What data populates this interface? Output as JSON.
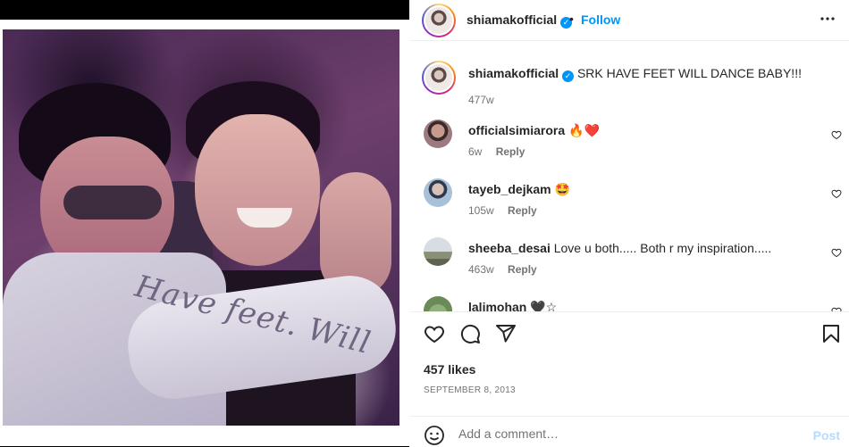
{
  "post": {
    "author": "shiamakofficial",
    "follow_label": "Follow",
    "separator": "•",
    "more_icon": "more-horizontal-icon",
    "caption": "SRK HAVE FEET WILL DANCE BABY!!!",
    "caption_age": "477w",
    "photo_print_text": "Have feet. Will"
  },
  "comments": [
    {
      "user": "officialsimiarora",
      "text": "🔥❤️",
      "age": "6w",
      "reply": "Reply"
    },
    {
      "user": "tayeb_dejkam",
      "text": "🤩",
      "age": "105w",
      "reply": "Reply"
    },
    {
      "user": "sheeba_desai",
      "text": "Love u both..... Both r my inspiration.....",
      "age": "463w",
      "reply": "Reply"
    },
    {
      "user": "lalimohan",
      "text": "🖤☆",
      "age": "",
      "reply": ""
    }
  ],
  "actions": {
    "like_icon": "heart-icon",
    "comment_icon": "comment-icon",
    "share_icon": "send-icon",
    "save_icon": "bookmark-icon"
  },
  "likes": "457 likes",
  "date": "SEPTEMBER 8, 2013",
  "composer": {
    "placeholder": "Add a comment…",
    "post_label": "Post",
    "emoji_icon": "smiley-icon"
  },
  "colors": {
    "accent": "#0095f6",
    "post_disabled": "#b3dbff",
    "muted": "#737373"
  }
}
